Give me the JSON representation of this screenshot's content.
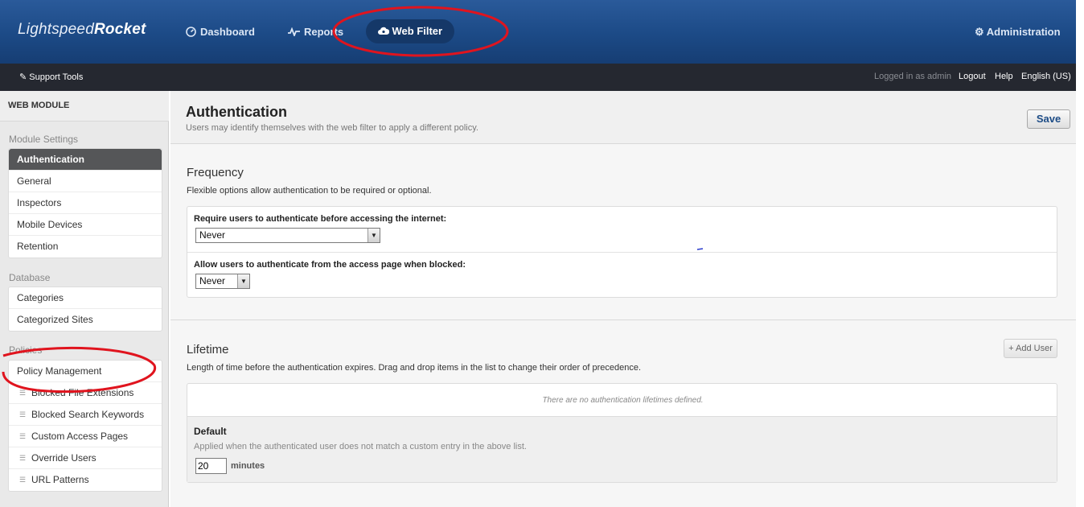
{
  "header": {
    "brand_light": "Lightspeed",
    "brand_bold": "Rocket",
    "nav": [
      {
        "label": "Dashboard",
        "icon": "dashboard-icon"
      },
      {
        "label": "Reports",
        "icon": "reports-pulse-icon"
      },
      {
        "label": "Web Filter",
        "icon": "cloud-filter-icon",
        "active": true
      }
    ],
    "admin_label": "Administration",
    "admin_icon": "gear-icon"
  },
  "subbar": {
    "support_label": "Support Tools",
    "support_icon": "wrench-icon",
    "logged_in": "Logged in as admin",
    "logout": "Logout",
    "help": "Help",
    "language": "English (US)"
  },
  "sidebar": {
    "title": "WEB MODULE",
    "sections": [
      {
        "label": "Module Settings",
        "items": [
          "Authentication",
          "General",
          "Inspectors",
          "Mobile Devices",
          "Retention"
        ]
      },
      {
        "label": "Database",
        "items": [
          "Categories",
          "Categorized Sites"
        ]
      },
      {
        "label": "Policies",
        "items": [
          "Policy Management",
          "Blocked File Extensions",
          "Blocked Search Keywords",
          "Custom Access Pages",
          "Override Users",
          "URL Patterns"
        ]
      }
    ],
    "active_item": "Authentication"
  },
  "main": {
    "title": "Authentication",
    "subtitle": "Users may identify themselves with the web filter to apply a different policy.",
    "save_label": "Save",
    "frequency": {
      "title": "Frequency",
      "description": "Flexible options allow authentication to be required or optional.",
      "require_label": "Require users to authenticate before accessing the internet:",
      "require_value": "Never",
      "allow_label": "Allow users to authenticate from the access page when blocked:",
      "allow_value": "Never"
    },
    "lifetime": {
      "title": "Lifetime",
      "description": "Length of time before the authentication expires. Drag and drop items in the list to change their order of precedence.",
      "add_user_label": "+ Add User",
      "empty_message": "There are no authentication lifetimes defined.",
      "default_title": "Default",
      "default_description": "Applied when the authenticated user does not match a custom entry in the above list.",
      "minutes_value": "20",
      "minutes_label": "minutes"
    }
  },
  "colors": {
    "header_blue": "#1c4a86",
    "subbar_dark": "#252830",
    "annotation_red": "#e0141e"
  }
}
